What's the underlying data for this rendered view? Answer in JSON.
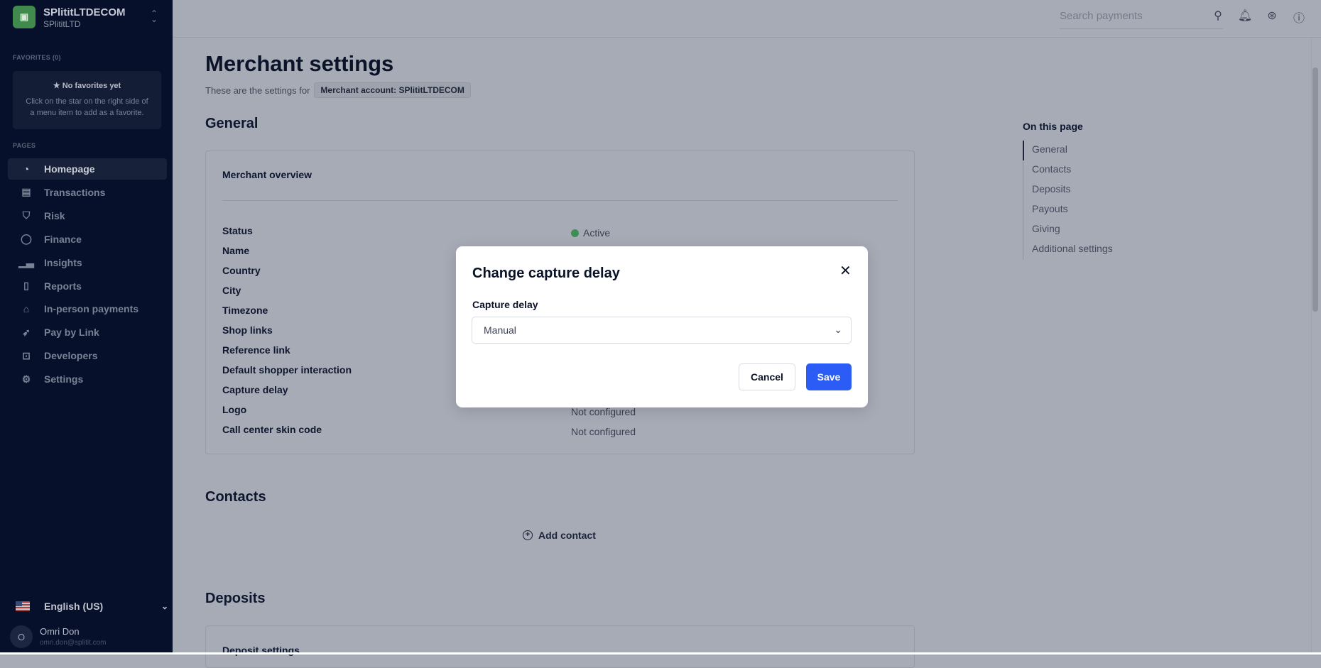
{
  "sidebar": {
    "account_name": "SPlititLTDECOM",
    "account_company": "SPlititLTD",
    "favorites_label": "FAVORITES (0)",
    "favorites_empty_title": "No favorites yet",
    "favorites_empty_desc": "Click on the star on the right side of a menu item to add as a favorite.",
    "pages_label": "PAGES",
    "items": [
      {
        "label": "Homepage",
        "icon": "gauge-icon",
        "active": true
      },
      {
        "label": "Transactions",
        "icon": "table-icon"
      },
      {
        "label": "Risk",
        "icon": "shield-icon"
      },
      {
        "label": "Finance",
        "icon": "coins-icon"
      },
      {
        "label": "Insights",
        "icon": "bar-chart-icon"
      },
      {
        "label": "Reports",
        "icon": "document-icon"
      },
      {
        "label": "In-person payments",
        "icon": "store-icon"
      },
      {
        "label": "Pay by Link",
        "icon": "paper-plane-icon"
      },
      {
        "label": "Developers",
        "icon": "terminal-icon"
      },
      {
        "label": "Settings",
        "icon": "gear-icon"
      }
    ],
    "language": "English (US)",
    "user_name": "Omri Don",
    "user_email": "omri.don@splitit.com",
    "user_initial": "O"
  },
  "header": {
    "search_placeholder": "Search payments"
  },
  "page": {
    "title": "Merchant settings",
    "subtitle": "These are the settings for",
    "account_chip": "Merchant account: SPlititLTDECOM",
    "general_heading": "General",
    "overview_title": "Merchant overview",
    "rows": [
      {
        "label": "Status",
        "value": "Active"
      },
      {
        "label": "Name",
        "value": ""
      },
      {
        "label": "Country",
        "value": ""
      },
      {
        "label": "City",
        "value": ""
      },
      {
        "label": "Timezone",
        "value": ""
      },
      {
        "label": "Shop links",
        "value": ""
      },
      {
        "label": "Reference link",
        "value": ""
      },
      {
        "label": "Default shopper interaction",
        "value": ""
      },
      {
        "label": "Capture delay",
        "value": ""
      },
      {
        "label": "Logo",
        "value": "Not configured"
      },
      {
        "label": "Call center skin code",
        "value": "Not configured"
      }
    ],
    "contacts_heading": "Contacts",
    "add_contact": "Add contact",
    "deposits_heading": "Deposits",
    "deposit_settings": "Deposit settings"
  },
  "toc": {
    "title": "On this page",
    "items": [
      "General",
      "Contacts",
      "Deposits",
      "Payouts",
      "Giving",
      "Additional settings"
    ]
  },
  "modal": {
    "title": "Change capture delay",
    "field_label": "Capture delay",
    "selected": "Manual",
    "cancel": "Cancel",
    "save": "Save"
  },
  "colors": {
    "primary": "#2b5cf6",
    "active_status": "#3f8d56",
    "sidebar": "#06102a"
  }
}
